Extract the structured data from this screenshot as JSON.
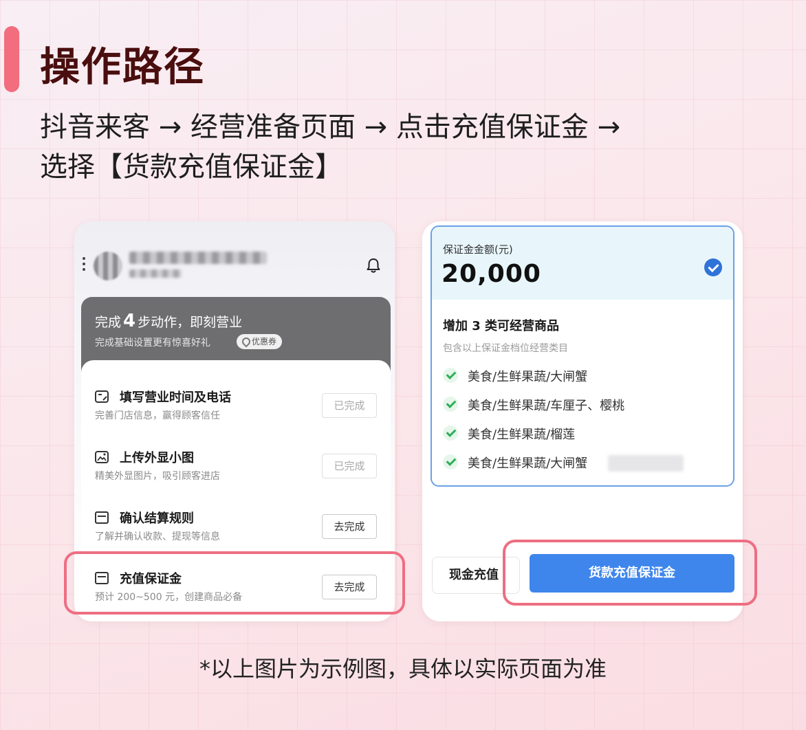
{
  "heading": {
    "title": "操作路径"
  },
  "path": {
    "line1": "抖音来客 → 经营准备页面 → 点击充值保证金 →",
    "line2": "选择【货款充值保证金】"
  },
  "left_card": {
    "panel": {
      "title_prefix": "完成",
      "title_number": "4",
      "title_suffix": "步动作，即刻营业",
      "subtitle": "完成基础设置更有惊喜好礼",
      "coupon_label": "优惠券"
    },
    "tasks": [
      {
        "icon": "calendar-edit-icon",
        "title": "填写营业时间及电话",
        "subtitle": "完善门店信息，赢得顾客信任",
        "button": "已完成",
        "status": "done"
      },
      {
        "icon": "image-upload-icon",
        "title": "上传外显小图",
        "subtitle": "精美外显图片，吸引顾客进店",
        "button": "已完成",
        "status": "done"
      },
      {
        "icon": "card-icon",
        "title": "确认结算规则",
        "subtitle": "了解并确认收款、提现等信息",
        "button": "去完成",
        "status": "todo"
      },
      {
        "icon": "card-icon",
        "title": "充值保证金",
        "subtitle": "预计 200~500 元，创建商品必备",
        "button": "去完成",
        "status": "todo"
      }
    ]
  },
  "right_card": {
    "deposit_label": "保证金金额(元)",
    "deposit_amount": "20,000",
    "categories_title": "增加 3 类可经营商品",
    "categories_subtitle": "包含以上保证金档位经营类目",
    "categories": [
      "美食/生鲜果蔬/大闸蟹",
      "美食/生鲜果蔬/车厘子、樱桃",
      "美食/生鲜果蔬/榴莲",
      "美食/生鲜果蔬/大闸蟹"
    ],
    "cash_button": "现金充值",
    "loan_button": "货款充值保证金"
  },
  "footnote": "*以上图片为示例图，具体以实际页面为准",
  "colors": {
    "accent": "#f26d7d",
    "highlight": "#ee6e82",
    "primary_blue": "#3e86ec",
    "check_green": "#2fae5a"
  }
}
